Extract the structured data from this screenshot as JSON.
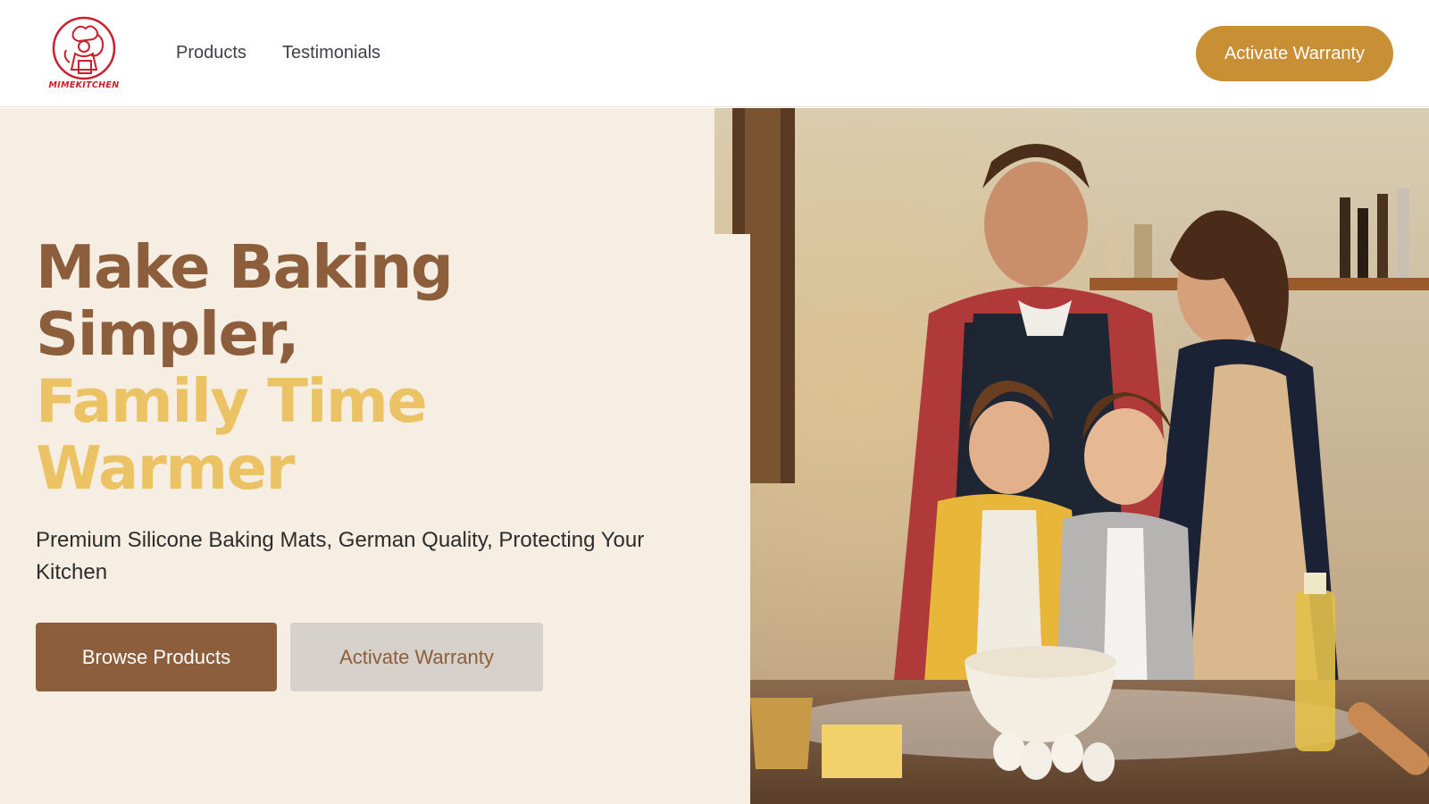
{
  "brand": {
    "name": "MIMEKITCHEN",
    "logo_color": "#c8202c"
  },
  "nav": {
    "items": [
      {
        "label": "Products"
      },
      {
        "label": "Testimonials"
      }
    ],
    "cta_label": "Activate Warranty"
  },
  "hero": {
    "headline_line1": "Make Baking",
    "headline_line2": "Simpler,",
    "headline_line3": "Family Time",
    "headline_line4": "Warmer",
    "subtitle": "Premium Silicone Baking Mats, German Quality, Protecting Your Kitchen",
    "primary_button": "Browse Products",
    "secondary_button": "Activate Warranty",
    "image_icon": "family-baking-photo"
  },
  "colors": {
    "primary_brown": "#8c5e3c",
    "gold": "#ebc365",
    "cta_gold": "#c98f35",
    "cream_bg": "#f6eee2",
    "secondary_button_bg": "#d6d1cb"
  }
}
